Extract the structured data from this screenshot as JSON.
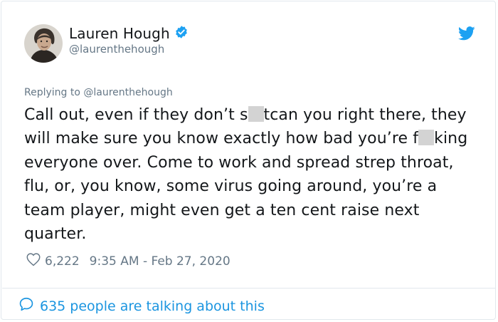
{
  "author": {
    "name": "Lauren Hough",
    "handle": "@laurenthehough",
    "verified": true,
    "verified_color": "#1da1f2"
  },
  "icons": {
    "verified": "verified-badge-icon",
    "brand": "twitter-bird-icon",
    "like": "heart-outline-icon",
    "reply_bubble": "comment-bubble-icon"
  },
  "tweet": {
    "replying_to": "Replying to @laurenthehough",
    "text_parts": {
      "p1": "Call out, even if they don’t s",
      "p2": "tcan you right there, they will make sure you know exactly how bad you’re f",
      "p3": "king everyone over. Come to work and spread strep throat, flu, or, you know, some virus going around, you’re a team player, might even get a ten cent raise next quarter."
    },
    "likes": "6,222",
    "timestamp": "9:35 AM - Feb 27, 2020"
  },
  "footer": {
    "talking": "635 people are talking about this"
  },
  "colors": {
    "brand_blue": "#1da1f2",
    "link_blue": "#1b95e0",
    "muted_gray": "#657786",
    "text_dark": "#14171a"
  }
}
